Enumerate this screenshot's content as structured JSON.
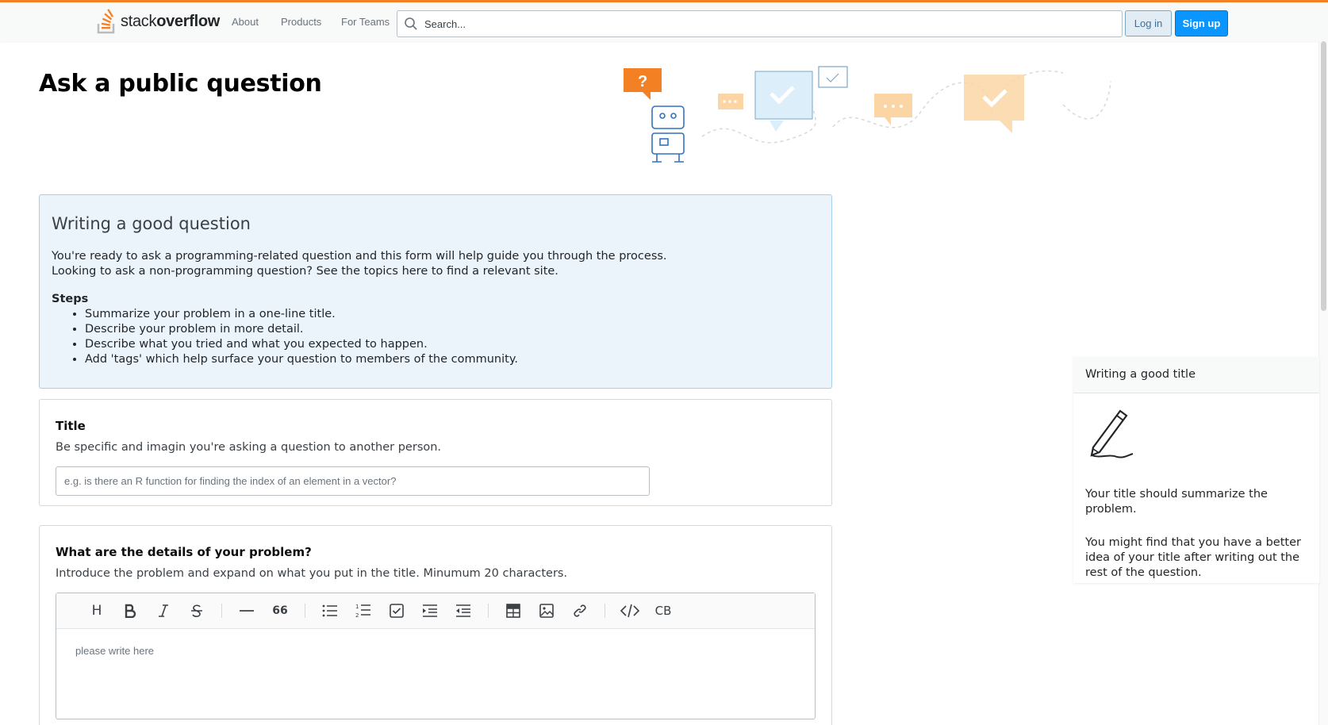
{
  "header": {
    "logo_text_light": "stack",
    "logo_text_bold": "overflow",
    "nav": [
      "About",
      "Products",
      "For Teams"
    ],
    "search_placeholder": "Search...",
    "login_label": "Log in",
    "signup_label": "Sign up",
    "accent_color": "#f48024"
  },
  "page": {
    "title": "Ask a public question"
  },
  "guide": {
    "heading": "Writing a good question",
    "intro_line1": "You're ready to ask a programming-related question and this form will help guide you through the process.",
    "intro_line2": "Looking to ask a non-programming question? See the topics here to find a relevant site.",
    "steps_title": "Steps",
    "steps": [
      "Summarize your problem in a one-line title.",
      "Describe your problem in more detail.",
      "Describe what you tried and what you expected to happen.",
      "Add 'tags' which help surface your question to members of the community."
    ]
  },
  "title_card": {
    "label": "Title",
    "description": "Be specific and imagin you're asking a question to another person.",
    "placeholder": "e.g. is there an R function for finding the index of an element in a vector?"
  },
  "details_card": {
    "label": "What are the details of your problem?",
    "description": "Introduce the problem and expand on what you put in the title. Minumum 20 characters.",
    "placeholder": "please write here",
    "toolbar": {
      "heading": "H",
      "quote": "66",
      "codeblock": "CB"
    }
  },
  "sidebar": {
    "heading": "Writing a good title",
    "text1": "Your title should summarize the problem.",
    "text2": "You might find that you have a better idea of your title after writing out the rest of the question."
  }
}
